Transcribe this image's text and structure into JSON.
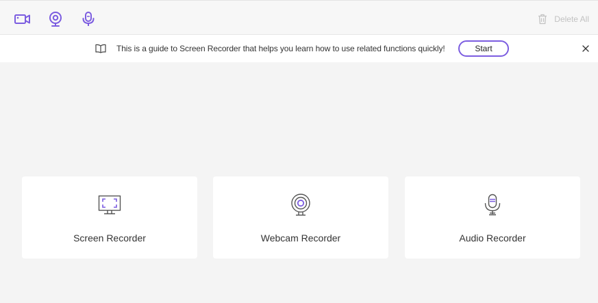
{
  "colors": {
    "accent": "#7b5ce0",
    "icon_gray": "#555555",
    "disabled": "#c2c2c2"
  },
  "toolbar": {
    "tools": [
      {
        "icon": "video-camera-icon"
      },
      {
        "icon": "webcam-icon"
      },
      {
        "icon": "microphone-icon"
      }
    ],
    "delete_all_label": "Delete All",
    "delete_icon": "trash-icon"
  },
  "guide": {
    "icon": "book-icon",
    "text": "This is a guide to Screen Recorder that helps you learn how to use related functions quickly!",
    "start_label": "Start",
    "close_icon": "close-icon"
  },
  "cards": [
    {
      "icon": "monitor-icon",
      "label": "Screen Recorder"
    },
    {
      "icon": "webcam-icon",
      "label": "Webcam Recorder"
    },
    {
      "icon": "microphone-icon",
      "label": "Audio Recorder"
    }
  ]
}
